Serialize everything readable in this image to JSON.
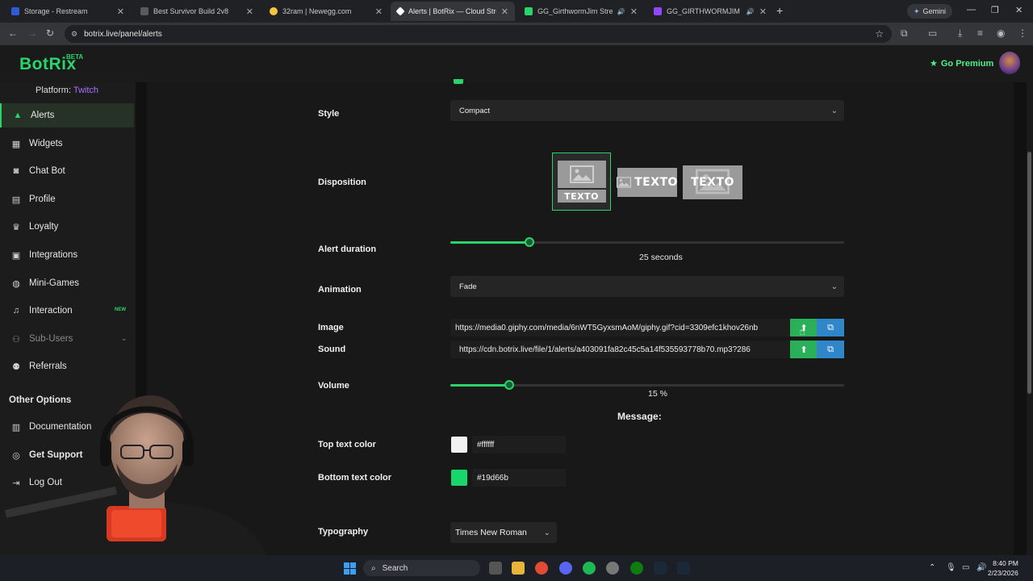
{
  "browser": {
    "tabs": [
      {
        "title": "Storage - Restream",
        "color": "#2f5bd6"
      },
      {
        "title": "Best Survivor Build 2v8",
        "color": "#5a5a5a"
      },
      {
        "title": "32ram | Newegg.com",
        "color": "#f5c542"
      },
      {
        "title": "Alerts | BotRix — Cloud Stream",
        "color": "#ffffff"
      },
      {
        "title": "GG_GirthwormJim Stream",
        "color": "#2bd46a"
      },
      {
        "title": "GG_GIRTHWORMJIM - Twit",
        "color": "#9146ff"
      }
    ],
    "gemini_label": "Gemini",
    "url": "botrix.live/panel/alerts"
  },
  "app": {
    "logo": "BotRix",
    "beta": "BETA",
    "premium": "Go Premium"
  },
  "sidebar": {
    "platform_label": "Platform:",
    "platform_value": "Twitch",
    "items": [
      {
        "label": "Alerts",
        "icon": "warning-icon"
      },
      {
        "label": "Widgets",
        "icon": "grid-icon"
      },
      {
        "label": "Chat Bot",
        "icon": "robot-icon"
      },
      {
        "label": "Profile",
        "icon": "id-card-icon"
      },
      {
        "label": "Loyalty",
        "icon": "trophy-icon"
      },
      {
        "label": "Integrations",
        "icon": "plug-icon"
      },
      {
        "label": "Mini-Games",
        "icon": "gamepad-icon"
      },
      {
        "label": "Interaction",
        "icon": "music-icon"
      },
      {
        "label": "Sub-Users",
        "icon": "users-icon"
      },
      {
        "label": "Referrals",
        "icon": "people-icon"
      }
    ],
    "interaction_badge": "NEW",
    "other_options": "Other Options",
    "other_items": [
      {
        "label": "Documentation",
        "icon": "book-icon"
      },
      {
        "label": "Get Support",
        "icon": "support-icon"
      },
      {
        "label": "Log Out",
        "icon": "logout-icon"
      }
    ]
  },
  "form": {
    "style_label": "Style",
    "style_value": "Compact",
    "disposition_label": "Disposition",
    "disposition_text": "TEXTO",
    "duration_label": "Alert duration",
    "duration_value": "25",
    "duration_unit": "seconds",
    "duration_fraction": 0.2,
    "animation_label": "Animation",
    "animation_value": "Fade",
    "image_label": "Image",
    "image_url": "https://media0.giphy.com/media/6nWT5GyxsmAoM/giphy.gif?cid=3309efc1khov26nb",
    "sound_label": "Sound",
    "sound_url": "https://cdn.botrix.live/file/1/alerts/a403091fa82c45c5a14f535593778b70.mp3?286",
    "volume_label": "Volume",
    "volume_value": "15",
    "volume_unit": "%",
    "volume_fraction": 0.15,
    "message_heading": "Message:",
    "top_color_label": "Top text color",
    "top_color_value": "#ffffff",
    "bottom_color_label": "Bottom text color",
    "bottom_color_value": "#19d66b",
    "typography_label": "Typography",
    "typography_value": "Times New Roman"
  },
  "taskbar": {
    "search_label": "Search",
    "time": "8:40 PM",
    "date": "2/23/2026"
  },
  "colors": {
    "accent": "#2bd46a",
    "twitch": "#a970ff",
    "upload": "#2bb05a",
    "library": "#2f86c9"
  }
}
